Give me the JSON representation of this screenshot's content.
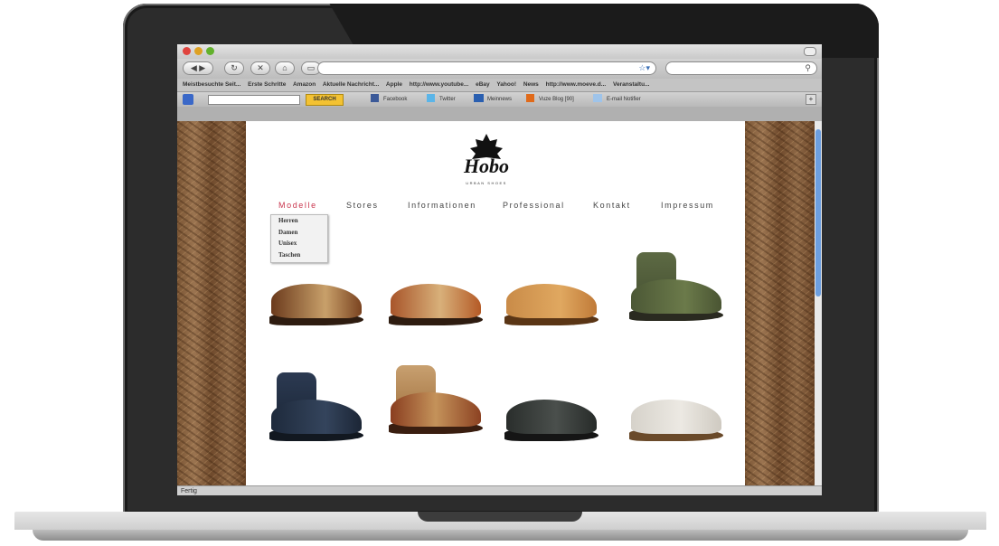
{
  "browser": {
    "bookmarks": [
      "Meistbesuchte Seit...",
      "Erste Schritte",
      "Amazon",
      "Aktuelle Nachricht...",
      "Apple",
      "http://www.youtube...",
      "eBay",
      "Yahoo!",
      "News",
      "http://www.moeve.d...",
      "Veranstaltu..."
    ],
    "toolbar": {
      "search_label": "SEARCH",
      "items": [
        "Facebook",
        "Twitter",
        "Meinnews",
        "Vuze Blog [90]",
        "E-mail Notifier"
      ]
    },
    "status": "Fertig"
  },
  "site": {
    "logo_text": "Hobo",
    "logo_subtitle": "URBAN SHOES",
    "nav": [
      "Modelle",
      "Stores",
      "Informationen",
      "Professional",
      "Kontakt",
      "Impressum"
    ],
    "dropdown": [
      "Herren",
      "Damen",
      "Unisex",
      "Taschen"
    ],
    "accent_color": "#c9344c"
  }
}
